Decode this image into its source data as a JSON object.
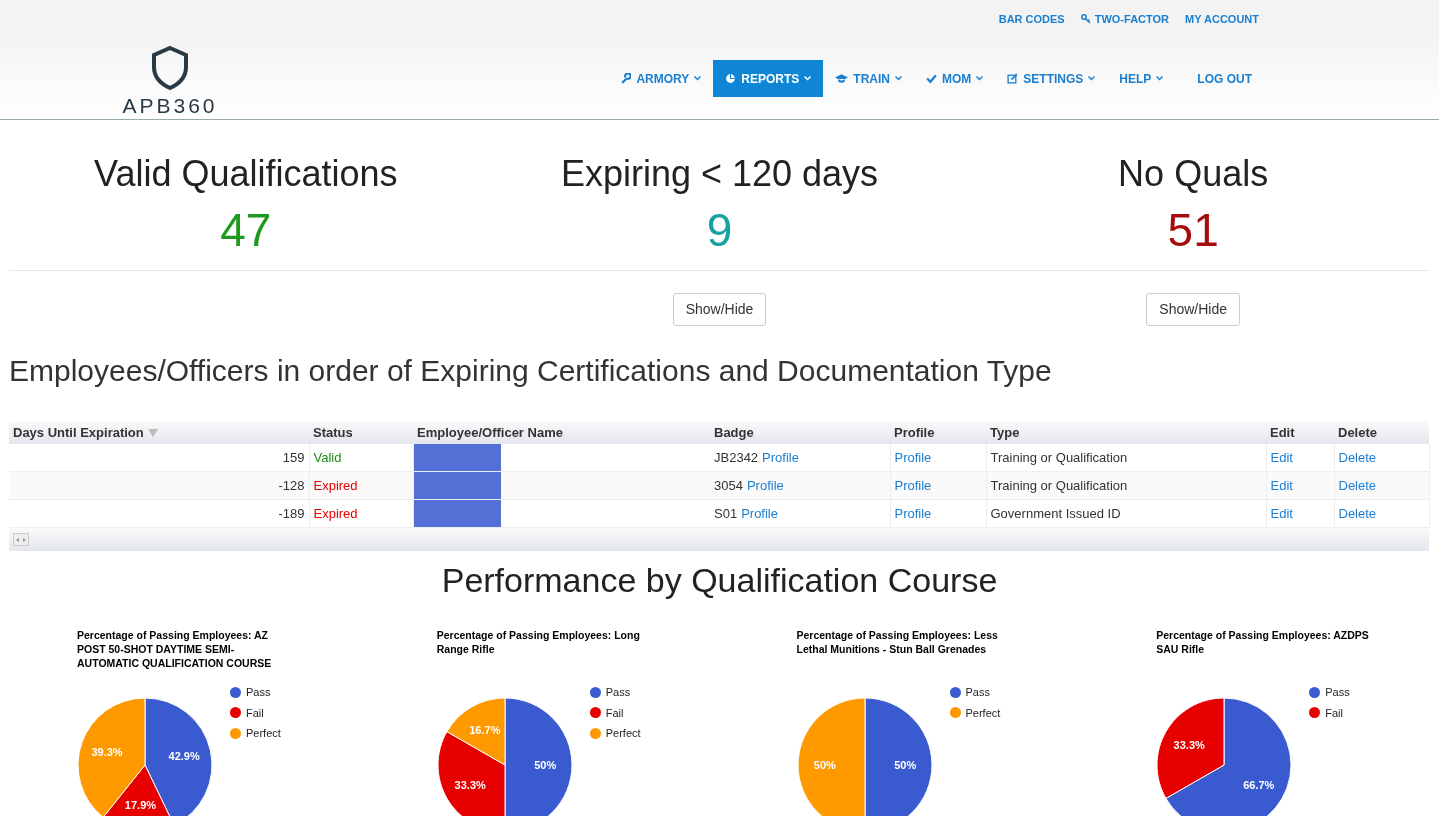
{
  "top_links": [
    {
      "label": "BAR CODES"
    },
    {
      "label": "TWO-FACTOR"
    },
    {
      "label": "MY ACCOUNT"
    }
  ],
  "logo": {
    "text": "APB360"
  },
  "nav": [
    {
      "label": "ARMORY",
      "dropdown": true,
      "selected": false
    },
    {
      "label": "REPORTS",
      "dropdown": true,
      "selected": true
    },
    {
      "label": "TRAIN",
      "dropdown": true,
      "selected": false
    },
    {
      "label": "MOM",
      "dropdown": true,
      "selected": false
    },
    {
      "label": "SETTINGS",
      "dropdown": true,
      "selected": false
    },
    {
      "label": "HELP",
      "dropdown": true,
      "selected": false
    },
    {
      "label": "LOG OUT",
      "dropdown": false,
      "selected": false
    }
  ],
  "stats": [
    {
      "title": "Valid Qualifications",
      "value": "47",
      "color": "#1e9a1e"
    },
    {
      "title": "Expiring < 120 days",
      "value": "9",
      "color": "#17a2a2",
      "button": "Show/Hide"
    },
    {
      "title": "No Quals",
      "value": "51",
      "color": "#a50d0d",
      "button": "Show/Hide"
    }
  ],
  "table": {
    "title": "Employees/Officers in order of Expiring Certifications and Documentation Type",
    "columns": [
      "Days Until Expiration",
      "Status",
      "Employee/Officer Name",
      "Badge",
      "Profile",
      "Type",
      "Edit",
      "Delete"
    ],
    "rows": [
      {
        "days": "159",
        "status": "Valid",
        "color": "#1a8a1a",
        "badge": "JB2342",
        "badge_link": "Profile",
        "profile": "Profile",
        "type": "Training or Qualification",
        "edit": "Edit",
        "delete": "Delete"
      },
      {
        "days": "-128",
        "status": "Expired",
        "color": "#e60000",
        "badge": "3054",
        "badge_link": "Profile",
        "profile": "Profile",
        "type": "Training or Qualification",
        "edit": "Edit",
        "delete": "Delete"
      },
      {
        "days": "-189",
        "status": "Expired",
        "color": "#e60000",
        "badge": "S01",
        "badge_link": "Profile",
        "profile": "Profile",
        "type": "Government Issued ID",
        "edit": "Edit",
        "delete": "Delete"
      }
    ]
  },
  "performance": {
    "title": "Performance by Qualification Course",
    "charts": [
      {
        "chart_data": {
          "type": "pie",
          "title": "Percentage of Passing Employees: AZ POST 50-SHOT DAYTIME SEMI-AUTOMATIC QUALIFICATION COURSE",
          "legend": "right",
          "categories": [
            "Pass",
            "Fail",
            "Perfect"
          ],
          "values": [
            42.9,
            17.9,
            39.3
          ],
          "colors": [
            "#3a5bcf",
            "#e60000",
            "#ff9900"
          ],
          "value_labels": [
            "42.9%",
            "17.9%",
            "39.3%"
          ]
        }
      },
      {
        "chart_data": {
          "type": "pie",
          "title": "Percentage of Passing Employees: Long Range Rifle",
          "legend": "right",
          "categories": [
            "Pass",
            "Fail",
            "Perfect"
          ],
          "values": [
            50,
            33.3,
            16.7
          ],
          "colors": [
            "#3a5bcf",
            "#e60000",
            "#ff9900"
          ],
          "value_labels": [
            "50%",
            "33.3%",
            "16.7%"
          ]
        }
      },
      {
        "chart_data": {
          "type": "pie",
          "title": "Percentage of Passing Employees: Less Lethal Munitions - Stun Ball Grenades",
          "legend": "right",
          "categories": [
            "Pass",
            "Perfect"
          ],
          "values": [
            50,
            50
          ],
          "colors": [
            "#3a5bcf",
            "#ff9900"
          ],
          "value_labels": [
            "50%",
            "50%"
          ]
        }
      },
      {
        "chart_data": {
          "type": "pie",
          "title": "Percentage of Passing Employees: AZDPS SAU Rifle",
          "legend": "right",
          "categories": [
            "Pass",
            "Fail"
          ],
          "values": [
            66.7,
            33.3
          ],
          "colors": [
            "#3a5bcf",
            "#e60000"
          ],
          "value_labels": [
            "66.7%",
            "33.3%"
          ]
        }
      }
    ]
  }
}
